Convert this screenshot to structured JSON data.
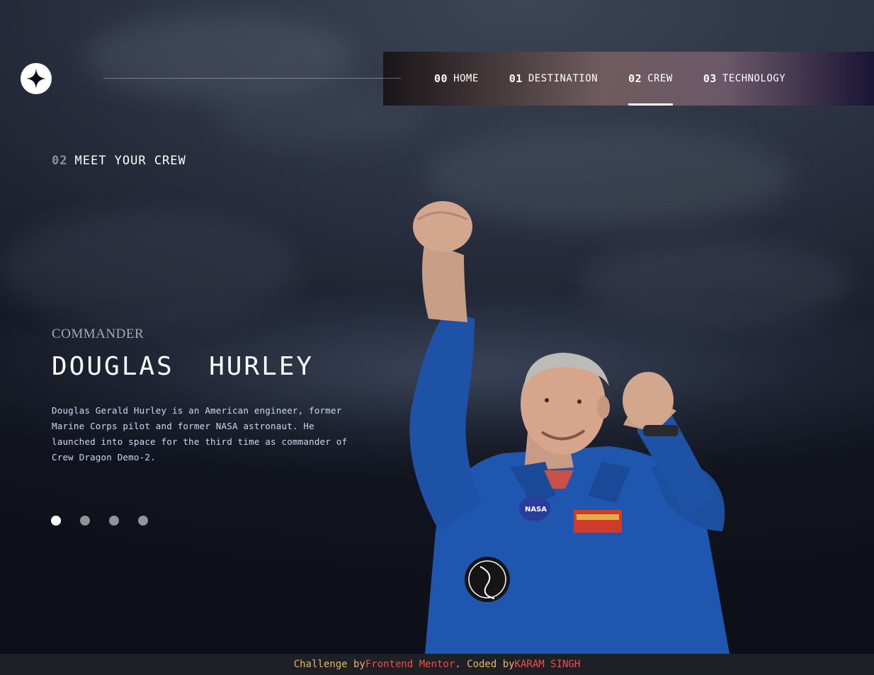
{
  "nav": {
    "items": [
      {
        "num": "00",
        "label": "HOME"
      },
      {
        "num": "01",
        "label": "DESTINATION"
      },
      {
        "num": "02",
        "label": "CREW"
      },
      {
        "num": "03",
        "label": "TECHNOLOGY"
      }
    ],
    "active_index": 2
  },
  "section": {
    "num": "02",
    "title": "MEET YOUR CREW"
  },
  "crew": {
    "role": "COMMANDER",
    "name": "DOUGLAS  HURLEY",
    "bio": "Douglas Gerald Hurley is an American engineer, former Marine Corps pilot and former NASA astronaut. He launched into space for the third time as commander of Crew Dragon Demo-2.",
    "slides_total": 4,
    "active_slide": 0
  },
  "footer": {
    "prefix": "Challenge by ",
    "challenge_link": "Frontend Mentor",
    "middle": ". Coded by ",
    "author_link": "KARAM SINGH"
  },
  "colors": {
    "background": "#0b0d17",
    "accent_text": "#d0d6f9",
    "footer_text": "#e6b66a",
    "footer_link": "#ef4f4f",
    "suit_blue": "#1f57b0"
  },
  "icons": {
    "logo": "star-logo-icon"
  }
}
